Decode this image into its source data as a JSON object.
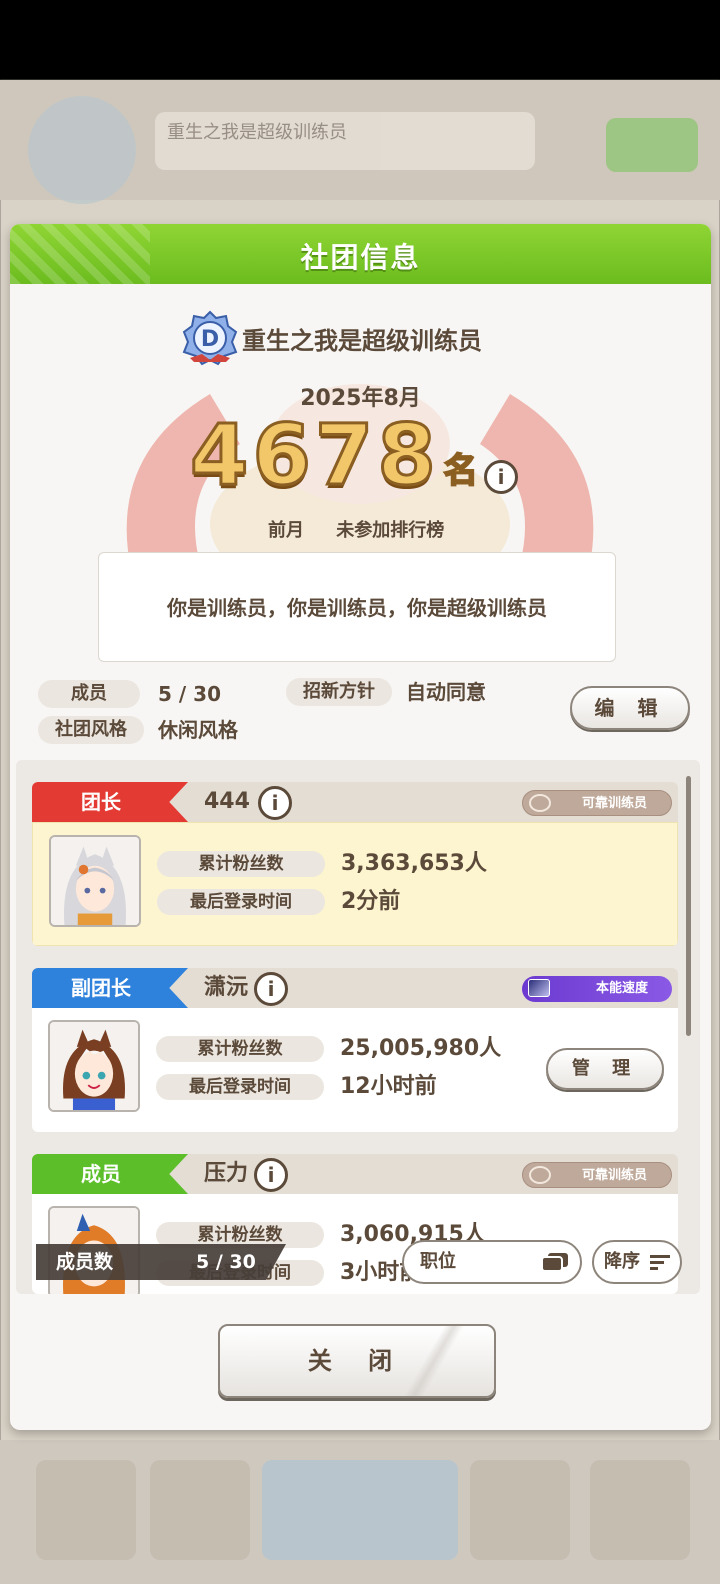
{
  "background": {
    "club_name_faded": "重生之我是超级训练员"
  },
  "dialog": {
    "title": "社团信息",
    "club_name": "重生之我是超级训练员",
    "month": "2025年8月",
    "rank_number": "4678",
    "rank_unit": "名",
    "info_glyph": "i",
    "prev_month_label": "前月",
    "prev_month_value": "未参加排行榜",
    "motto": "你是训练员，你是训练员，你是超级训练员",
    "members_label": "成员",
    "members_value": "5 / 30",
    "recruit_label": "招新方针",
    "recruit_value": "自动同意",
    "style_label": "社团风格",
    "style_value": "休闲风格",
    "edit_label": "编 辑",
    "close_label": "关 闭"
  },
  "member_list": [
    {
      "role": "团长",
      "role_color": "#e43a34",
      "name": "444",
      "title_badge": "可靠训练员",
      "fans_label": "累计粉丝数",
      "fans_value": "3,363,653人",
      "login_label": "最后登录时间",
      "login_value": "2分前"
    },
    {
      "role": "副团长",
      "role_color": "#2f82dc",
      "name": "潇沅",
      "title_badge": "本能速度",
      "fans_label": "累计粉丝数",
      "fans_value": "25,005,980人",
      "login_label": "最后登录时间",
      "login_value": "12小时前",
      "manage_label": "管 理"
    },
    {
      "role": "成员",
      "role_color": "#5cbf2a",
      "name": "压力",
      "title_badge": "可靠训练员",
      "fans_label": "累计粉丝数",
      "fans_value": "3,060,915人",
      "login_label": "最后登录时间",
      "login_value": "3小时前"
    }
  ],
  "footer_bar": {
    "count_label": "成员数",
    "count_value": "5 / 30",
    "sort_field": "职位",
    "sort_order": "降序"
  },
  "colors": {
    "header_green": "#7ac82a",
    "text_brown": "#5b4a3a",
    "gold": "#f1c76a"
  }
}
